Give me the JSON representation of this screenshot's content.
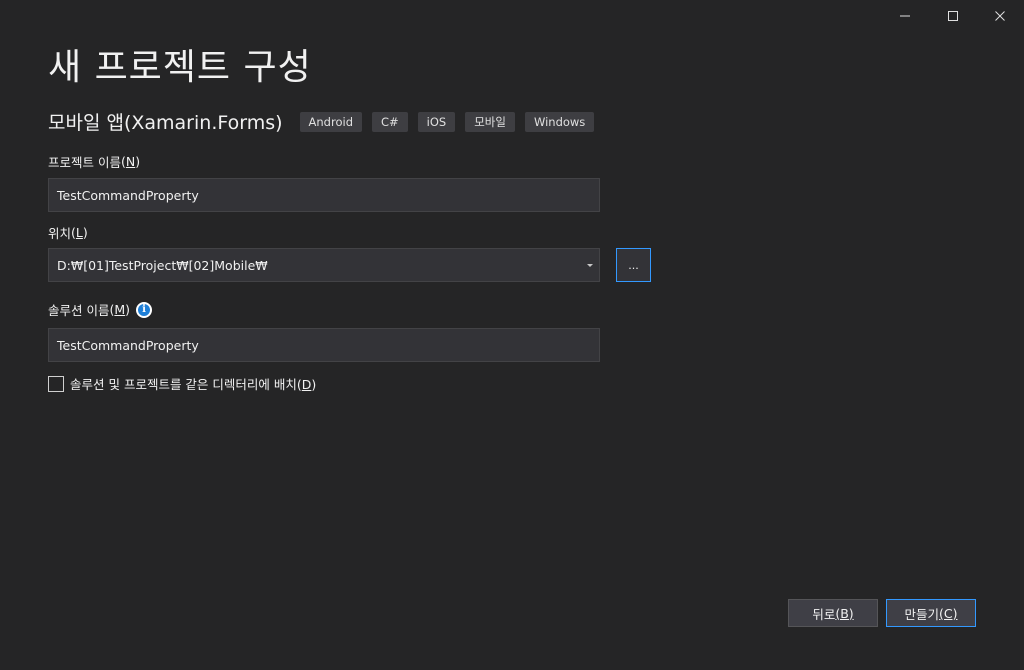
{
  "window": {
    "minimize_icon": "minimize-icon",
    "maximize_icon": "maximize-icon",
    "close_icon": "close-icon"
  },
  "page_title": "새 프로젝트 구성",
  "template": {
    "name": "모바일 앱(Xamarin.Forms)",
    "tags": [
      "Android",
      "C#",
      "iOS",
      "모바일",
      "Windows"
    ]
  },
  "project_name": {
    "label": "프로젝트 이름",
    "mnemonic_open": "(",
    "mnemonic": "N",
    "mnemonic_close": ")",
    "value": "TestCommandProperty"
  },
  "location": {
    "label": "위치",
    "mnemonic_open": "(",
    "mnemonic": "L",
    "mnemonic_close": ")",
    "value": "D:₩[01]TestProject₩[02]Mobile₩",
    "browse_label": "..."
  },
  "solution_name": {
    "label": "솔루션 이름",
    "mnemonic_open": "(",
    "mnemonic": "M",
    "mnemonic_close": ")",
    "value": "TestCommandProperty",
    "info_icon": "info-icon",
    "info_glyph": "i"
  },
  "same_directory": {
    "label": "솔루션 및 프로젝트를 같은 디렉터리에 배치",
    "mnemonic_open": "(",
    "mnemonic": "D",
    "mnemonic_close": ")",
    "checked": false
  },
  "footer": {
    "back_label": "뒤로",
    "back_mnemonic": "(B)",
    "create_label": "만들기",
    "create_mnemonic": "(C)"
  },
  "colors": {
    "background": "#252526",
    "field_background": "#333337",
    "accent": "#3399ff",
    "info_blue": "#1e7fd8"
  }
}
